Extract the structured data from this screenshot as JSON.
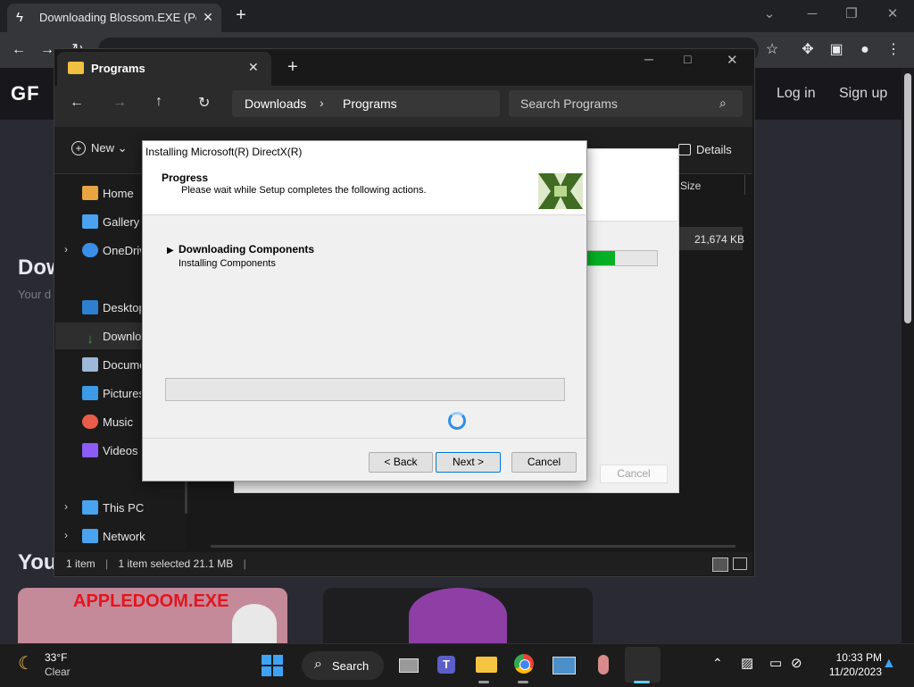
{
  "browser": {
    "tab_title": "Downloading Blossom.EXE (Pow",
    "favicon": "lightning-icon",
    "omnibox_text": "",
    "win_controls": [
      "minimize",
      "restore",
      "close"
    ]
  },
  "site": {
    "logo": "GF",
    "login": "Log in",
    "signup": "Sign up",
    "heading_partial": "Dow",
    "subtext_partial": "Your d",
    "section_partial": "You",
    "card1_text": "APPLEDOOM.EXE"
  },
  "explorer": {
    "tab_title": "Programs",
    "breadcrumb": [
      "Downloads",
      "Programs"
    ],
    "search_placeholder": "Search Programs",
    "new_label": "New",
    "details_label": "Details",
    "column_size": "Size",
    "file_size": "21,674 KB",
    "nav": [
      {
        "label": "Home",
        "color": "#e8a440"
      },
      {
        "label": "Gallery",
        "color": "#4aa3f0"
      },
      {
        "label": "OneDrive",
        "color": "#3b8ee8"
      },
      {
        "label": "Desktop",
        "color": "#2f7fd0"
      },
      {
        "label": "Downloads",
        "color": "#2ea043"
      },
      {
        "label": "Documents",
        "color": "#9db8d8"
      },
      {
        "label": "Pictures",
        "color": "#3b9be8"
      },
      {
        "label": "Music",
        "color": "#e85d4a"
      },
      {
        "label": "Videos",
        "color": "#8b5cf6"
      },
      {
        "label": "This PC",
        "color": "#4aa3f0"
      },
      {
        "label": "Network",
        "color": "#4aa3f0"
      }
    ],
    "status": {
      "count": "1 item",
      "selected": "1 item selected  21.1 MB"
    }
  },
  "bg_window": {
    "cancel_label": "Cancel",
    "progress": 0.4
  },
  "dialog": {
    "title": "Installing Microsoft(R) DirectX(R)",
    "header_title": "Progress",
    "header_desc": "Please wait while Setup completes the following actions.",
    "step_title": "Downloading Components",
    "step_sub": "Installing Components",
    "progress": 0,
    "buttons": {
      "back": "< Back",
      "next": "Next >",
      "cancel": "Cancel"
    }
  },
  "taskbar": {
    "weather_temp": "33°F",
    "weather_desc": "Clear",
    "search_label": "Search",
    "time": "10:33 PM",
    "date": "11/20/2023"
  },
  "colors": {
    "accent": "#0078d4",
    "progress_green": "#06b025"
  }
}
